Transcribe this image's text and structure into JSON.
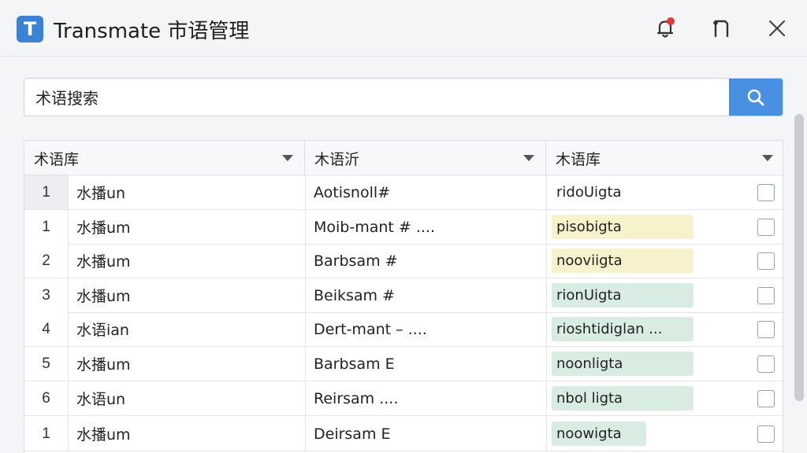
{
  "window": {
    "logo_letter": "T",
    "title": "Transmate 市语管理"
  },
  "search": {
    "value": "术语搜索",
    "placeholder": "术语搜索"
  },
  "table": {
    "headers": [
      "术语库",
      "木语沂",
      "木语库"
    ],
    "rows": [
      {
        "num": "1",
        "source": "水播un",
        "target": "Aotisnoll#",
        "note": "ridoUigta",
        "note_color": "none",
        "checked": false
      },
      {
        "num": "1",
        "source": "水播um",
        "target": "Moib-mant #  ....",
        "note": "pisobigta",
        "note_color": "yellow",
        "checked": false
      },
      {
        "num": "2",
        "source": "水播um",
        "target": "Barbsam #",
        "note": "nooviigta",
        "note_color": "yellow",
        "checked": false
      },
      {
        "num": "3",
        "source": "水播um",
        "target": "Beiksam #",
        "note": "rionUigta",
        "note_color": "green",
        "checked": false
      },
      {
        "num": "4",
        "source": "水语ian",
        "target": "Dert-mant – ....",
        "note": "rioshtidiglan ...",
        "note_color": "green",
        "checked": false
      },
      {
        "num": "5",
        "source": "水播um",
        "target": "Barbsam E",
        "note": "noonligta",
        "note_color": "green",
        "checked": false
      },
      {
        "num": "6",
        "source": "水语un",
        "target": "Reirsam    ....",
        "note": "nbol ligta",
        "note_color": "green",
        "checked": false
      },
      {
        "num": "1",
        "source": "水播um",
        "target": "Deirsam E",
        "note": "noowigta",
        "note_color": "green",
        "checked": false
      }
    ]
  },
  "colors": {
    "accent": "#4a90e2",
    "logo": "#3b82d6",
    "notification_dot": "#e53935",
    "chip_yellow": "#f7f1cc",
    "chip_green": "#d9ece2"
  }
}
